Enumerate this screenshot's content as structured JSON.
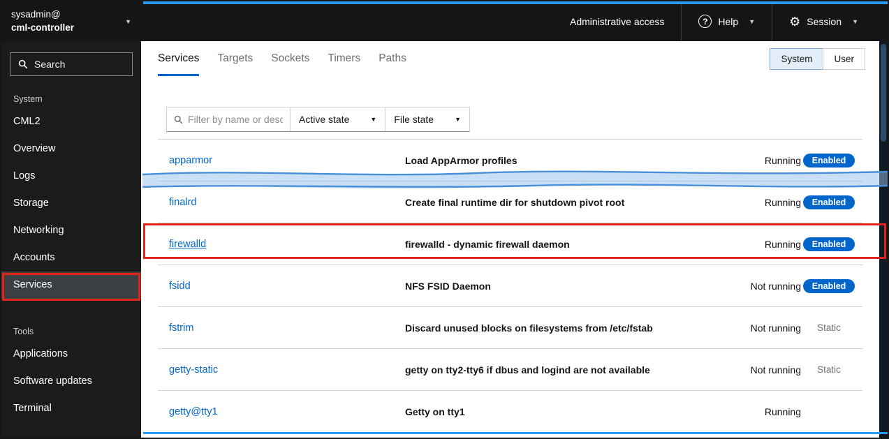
{
  "masthead": {
    "user": "sysadmin@",
    "host": "cml-controller",
    "admin_access": "Administrative access",
    "help": "Help",
    "session": "Session"
  },
  "sidebar": {
    "search_placeholder": "Search",
    "system_section": "System",
    "tools_section": "Tools",
    "system_items": [
      "CML2",
      "Overview",
      "Logs",
      "Storage",
      "Networking",
      "Accounts",
      "Services"
    ],
    "tools_items": [
      "Applications",
      "Software updates",
      "Terminal"
    ],
    "active_item": "Services"
  },
  "main": {
    "tabs": [
      "Services",
      "Targets",
      "Sockets",
      "Timers",
      "Paths"
    ],
    "active_tab": "Services",
    "scope": {
      "system": "System",
      "user": "User",
      "selected": "System"
    },
    "filter": {
      "search_placeholder": "Filter by name or desc...",
      "active_state": "Active state",
      "file_state": "File state"
    },
    "services": [
      {
        "name": "apparmor",
        "description": "Load AppArmor profiles",
        "state": "Running",
        "file_state": "Enabled"
      },
      {
        "name": "finalrd",
        "description": "Create final runtime dir for shutdown pivot root",
        "state": "Running",
        "file_state": "Enabled"
      },
      {
        "name": "firewalld",
        "description": "firewalld - dynamic firewall daemon",
        "state": "Running",
        "file_state": "Enabled"
      },
      {
        "name": "fsidd",
        "description": "NFS FSID Daemon",
        "state": "Not running",
        "file_state": "Enabled"
      },
      {
        "name": "fstrim",
        "description": "Discard unused blocks on filesystems from /etc/fstab",
        "state": "Not running",
        "file_state": "Static"
      },
      {
        "name": "getty-static",
        "description": "getty on tty2-tty6 if dbus and logind are not available",
        "state": "Not running",
        "file_state": "Static"
      },
      {
        "name": "getty@tty1",
        "description": "Getty on tty1",
        "state": "Running",
        "file_state": ""
      }
    ]
  },
  "colors": {
    "accent_blue": "#0066cc",
    "annotation_red": "#e2231a",
    "annotation_blue": "#2b9af3"
  }
}
